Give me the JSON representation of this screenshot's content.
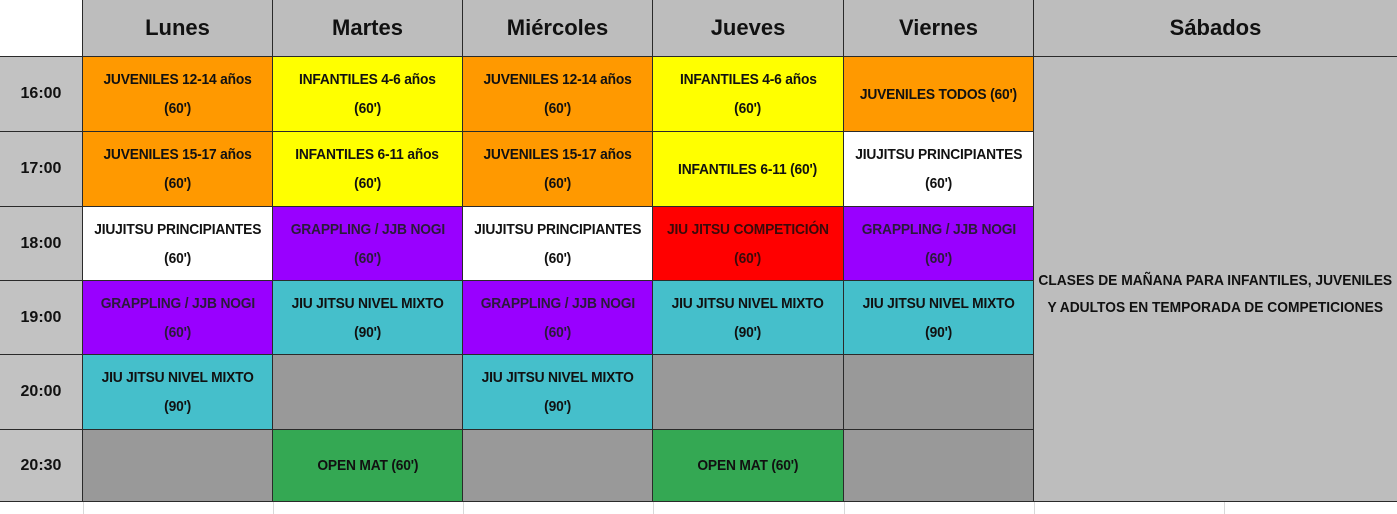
{
  "days": [
    "Lunes",
    "Martes",
    "Miércoles",
    "Jueves",
    "Viernes",
    "Sábados"
  ],
  "times": [
    "16:00",
    "17:00",
    "18:00",
    "19:00",
    "20:00",
    "20:30"
  ],
  "rows": [
    [
      {
        "color": "orange",
        "line1": "JUVENILES 12-14 años",
        "line2": "(60')"
      },
      {
        "color": "yellow",
        "line1": "INFANTILES 4-6 años",
        "line2": "(60')"
      },
      {
        "color": "orange",
        "line1": "JUVENILES 12-14 años",
        "line2": "(60')"
      },
      {
        "color": "yellow",
        "line1": "INFANTILES 4-6 años",
        "line2": "(60')"
      },
      {
        "color": "orange",
        "line1": "JUVENILES TODOS   (60')",
        "line2": ""
      }
    ],
    [
      {
        "color": "orange",
        "line1": "JUVENILES 15-17 años",
        "line2": "(60')"
      },
      {
        "color": "yellow",
        "line1": "INFANTILES 6-11 años",
        "line2": "(60')"
      },
      {
        "color": "orange",
        "line1": "JUVENILES 15-17 años",
        "line2": "(60')"
      },
      {
        "color": "yellow",
        "line1": "INFANTILES 6-11      (60')",
        "line2": ""
      },
      {
        "color": "white",
        "line1": "JIUJITSU PRINCIPIANTES",
        "line2": "(60')"
      }
    ],
    [
      {
        "color": "white",
        "line1": "JIUJITSU PRINCIPIANTES",
        "line2": "(60')"
      },
      {
        "color": "purple",
        "line1": "GRAPPLING / JJB NOGI",
        "line2": "(60')"
      },
      {
        "color": "white",
        "line1": "JIUJITSU PRINCIPIANTES",
        "line2": "(60')"
      },
      {
        "color": "red",
        "line1": "JIU JITSU COMPETICIÓN",
        "line2": "(60')"
      },
      {
        "color": "purple",
        "line1": "GRAPPLING / JJB NOGI",
        "line2": "(60')"
      }
    ],
    [
      {
        "color": "purple",
        "line1": "GRAPPLING / JJB NOGI",
        "line2": "(60')"
      },
      {
        "color": "teal",
        "line1": "JIU JITSU NIVEL MIXTO",
        "line2": "(90')"
      },
      {
        "color": "purple",
        "line1": "GRAPPLING / JJB NOGI",
        "line2": "(60')"
      },
      {
        "color": "teal",
        "line1": "JIU JITSU NIVEL MIXTO",
        "line2": "(90')"
      },
      {
        "color": "teal",
        "line1": "JIU JITSU NIVEL MIXTO",
        "line2": "(90')"
      }
    ],
    [
      {
        "color": "teal",
        "line1": "JIU JITSU NIVEL MIXTO",
        "line2": "(90')"
      },
      {
        "color": "gray",
        "line1": "",
        "line2": ""
      },
      {
        "color": "teal",
        "line1": "JIU JITSU NIVEL MIXTO",
        "line2": "(90')"
      },
      {
        "color": "gray",
        "line1": "",
        "line2": ""
      },
      {
        "color": "gray",
        "line1": "",
        "line2": ""
      }
    ],
    [
      {
        "color": "gray",
        "line1": "",
        "line2": ""
      },
      {
        "color": "green",
        "line1": "OPEN MAT (60')",
        "line2": ""
      },
      {
        "color": "gray",
        "line1": "",
        "line2": ""
      },
      {
        "color": "green",
        "line1": "OPEN MAT (60')",
        "line2": ""
      },
      {
        "color": "gray",
        "line1": "",
        "line2": ""
      }
    ]
  ],
  "saturday": {
    "line1": "CLASES DE MAÑANA PARA INFANTILES, JUVENILES",
    "line2": "Y ADULTOS EN TEMPORADA DE COMPETICIONES"
  },
  "colors": {
    "orange": "#ff9900",
    "yellow": "#ffff00",
    "white": "#ffffff",
    "purple": "#9900ff",
    "red": "#ff0000",
    "teal": "#45bfcb",
    "green": "#34a853",
    "gray": "#999999",
    "header_gray": "#bdbdbd"
  }
}
